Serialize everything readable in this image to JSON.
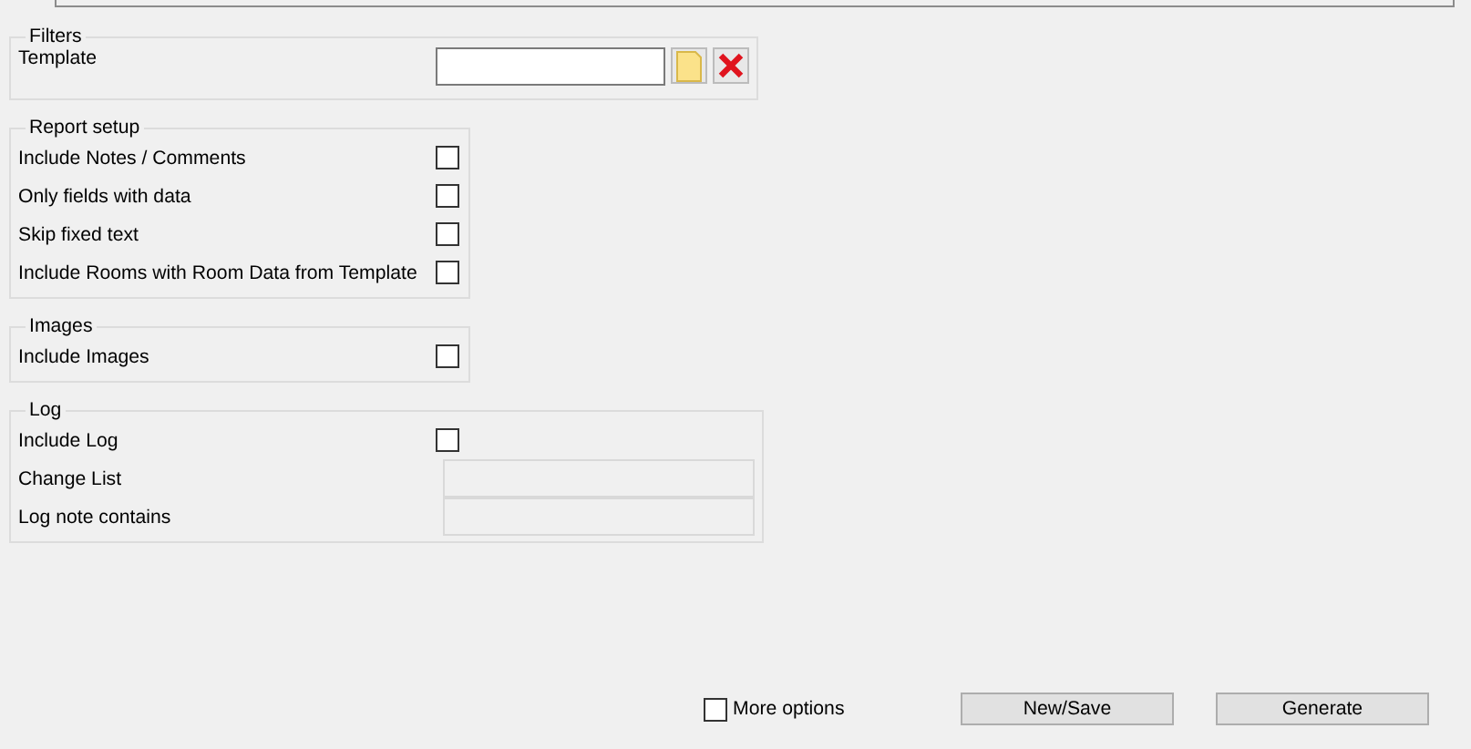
{
  "filters": {
    "legend": "Filters",
    "template": {
      "label": "Template"
    }
  },
  "report_setup": {
    "legend": "Report setup",
    "options": [
      {
        "label": "Include Notes / Comments",
        "checked": false
      },
      {
        "label": "Only fields with data",
        "checked": false
      },
      {
        "label": "Skip fixed text",
        "checked": false
      },
      {
        "label": "Include Rooms with Room Data from Template",
        "checked": false
      }
    ]
  },
  "images": {
    "legend": "Images",
    "options": [
      {
        "label": "Include Images",
        "checked": false
      }
    ]
  },
  "log": {
    "legend": "Log",
    "options": [
      {
        "label": "Include Log",
        "checked": false
      }
    ],
    "fields": [
      {
        "label": "Change List",
        "disabled": true
      },
      {
        "label": "Log note contains",
        "disabled": true
      }
    ]
  },
  "footer": {
    "more_options": {
      "label": "More options",
      "checked": false
    },
    "buttons": [
      "New/Save",
      "Generate"
    ]
  }
}
